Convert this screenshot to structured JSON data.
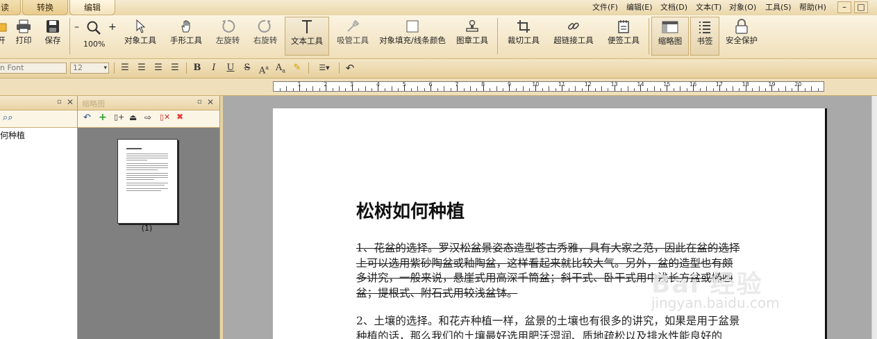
{
  "tabs": [
    "读",
    "转换",
    "编辑"
  ],
  "menu": [
    "文件(F)",
    "编辑(E)",
    "文档(D)",
    "文本(T)",
    "对象(O)",
    "工具(S)",
    "帮助(H)"
  ],
  "window_controls": [
    "–",
    "□"
  ],
  "toolbar": {
    "open": "开",
    "print": "打印",
    "save": "保存",
    "zoom_minus": "–",
    "zoom_plus": "+",
    "zoom": "100%",
    "object_tool": "对象工具",
    "hand_tool": "手形工具",
    "rotate_left": "左旋转",
    "rotate_right": "右旋转",
    "text_tool": "文本工具",
    "eyedropper": "吸管工具",
    "fill_color": "对象填充/线条颜色",
    "stamp_tool": "图章工具",
    "crop_tool": "裁切工具",
    "link_tool": "超链接工具",
    "note_tool": "便签工具",
    "thumbnail": "缩略图",
    "bookmark": "书签",
    "security": "安全保护"
  },
  "format": {
    "font": "n Font",
    "size": "12"
  },
  "ruler_ticks": [
    "1",
    "2",
    "3",
    "4",
    "5",
    "6",
    "7",
    "8",
    "9",
    "10",
    "11",
    "12",
    "13",
    "14",
    "15",
    "16",
    "17",
    "18",
    "19",
    "20"
  ],
  "bookmarks": {
    "item": "何种植"
  },
  "thumbnails": {
    "title": "缩略图",
    "page_label": "(1)"
  },
  "document": {
    "title": "松树如何种植",
    "para1": "1、花盆的选择。罗汉松盆景姿态造型苍古秀雅，具有大家之范，因此在盆的选择上可以选用紫砂陶盆或釉陶盆，这样看起来就比较大气。另外，盆的造型也有颇多讲究，一般来说，悬崖式用高深千筒盆；斜干式、卧干式用中浅长方盆或椭圆盆；提根式、附石式用较浅盆钵。",
    "para2": "2、土壤的选择。和花卉种植一样，盆景的土壤也有很多的讲究，如果是用于盆景种植的话，那么我们的土壤最好选用肥沃湿润、质地疏松以及排水性能良好的"
  },
  "watermark": {
    "brand": "Bai 经验",
    "url": "jingyan.baidu.com"
  }
}
